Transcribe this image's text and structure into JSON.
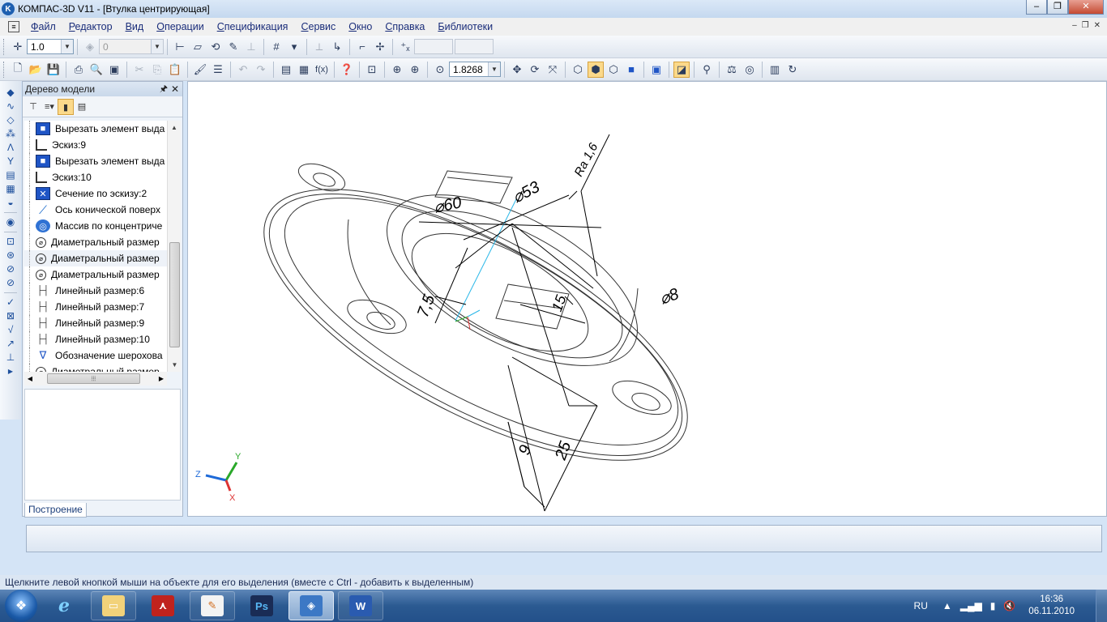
{
  "window": {
    "app_icon_letter": "K",
    "title": "КОМПАС-3D V11 - [Втулка центрирующая]"
  },
  "menu": [
    "Файл",
    "Редактор",
    "Вид",
    "Операции",
    "Спецификация",
    "Сервис",
    "Окно",
    "Справка",
    "Библиотеки"
  ],
  "toolbar_top": {
    "step_value": "1.0",
    "layer_value": "0"
  },
  "toolbar_main": {
    "zoom_value": "1.8268",
    "fx_label": "f(x)"
  },
  "tree": {
    "title": "Дерево модели",
    "tab_label": "Построение",
    "items": [
      {
        "label": "Вырезать элемент выда",
        "icon": "cut-extrude-icon"
      },
      {
        "label": "Эскиз:9",
        "icon": "sketch-icon"
      },
      {
        "label": "Вырезать элемент выда",
        "icon": "cut-extrude-icon"
      },
      {
        "label": "Эскиз:10",
        "icon": "sketch-icon"
      },
      {
        "label": "Сечение по эскизу:2",
        "icon": "section-icon"
      },
      {
        "label": "Ось конической поверх",
        "icon": "axis-icon"
      },
      {
        "label": "Массив по концентриче",
        "icon": "array-icon"
      },
      {
        "label": "Диаметральный размер",
        "icon": "diameter-icon"
      },
      {
        "label": "Диаметральный размер",
        "icon": "diameter-icon"
      },
      {
        "label": "Диаметральный размер",
        "icon": "diameter-icon"
      },
      {
        "label": "Линейный размер:6",
        "icon": "linear-dim-icon"
      },
      {
        "label": "Линейный размер:7",
        "icon": "linear-dim-icon"
      },
      {
        "label": "Линейный размер:9",
        "icon": "linear-dim-icon"
      },
      {
        "label": "Линейный размер:10",
        "icon": "linear-dim-icon"
      },
      {
        "label": "Обозначение шерохова",
        "icon": "roughness-icon"
      },
      {
        "label": "Диаметральный размер",
        "icon": "diameter-icon"
      }
    ]
  },
  "drawing": {
    "dims": {
      "d60": "⌀60",
      "d53": "⌀53",
      "d8": "⌀8",
      "ra": "Ra 1,6",
      "l75": "7,5",
      "l15": "15",
      "l9": "9",
      "l25": "25"
    },
    "axes": {
      "x": "X",
      "y": "Y",
      "z": "Z"
    }
  },
  "status": "Щелкните левой кнопкой мыши на объекте для его выделения (вместе с Ctrl - добавить к выделенным)",
  "taskbar": {
    "apps": [
      "ie-icon",
      "explorer-icon",
      "acrobat-icon",
      "compass-pen-icon",
      "photoshop-icon",
      "kompas-icon",
      "word-icon"
    ],
    "ps_label": "Ps",
    "word_label": "W",
    "lang": "RU",
    "time": "16:36",
    "date": "06.11.2010"
  },
  "colors": {
    "titlebar": "#c4d8ef",
    "taskbar": "#2b5a91",
    "selection": "#fbd98a"
  }
}
